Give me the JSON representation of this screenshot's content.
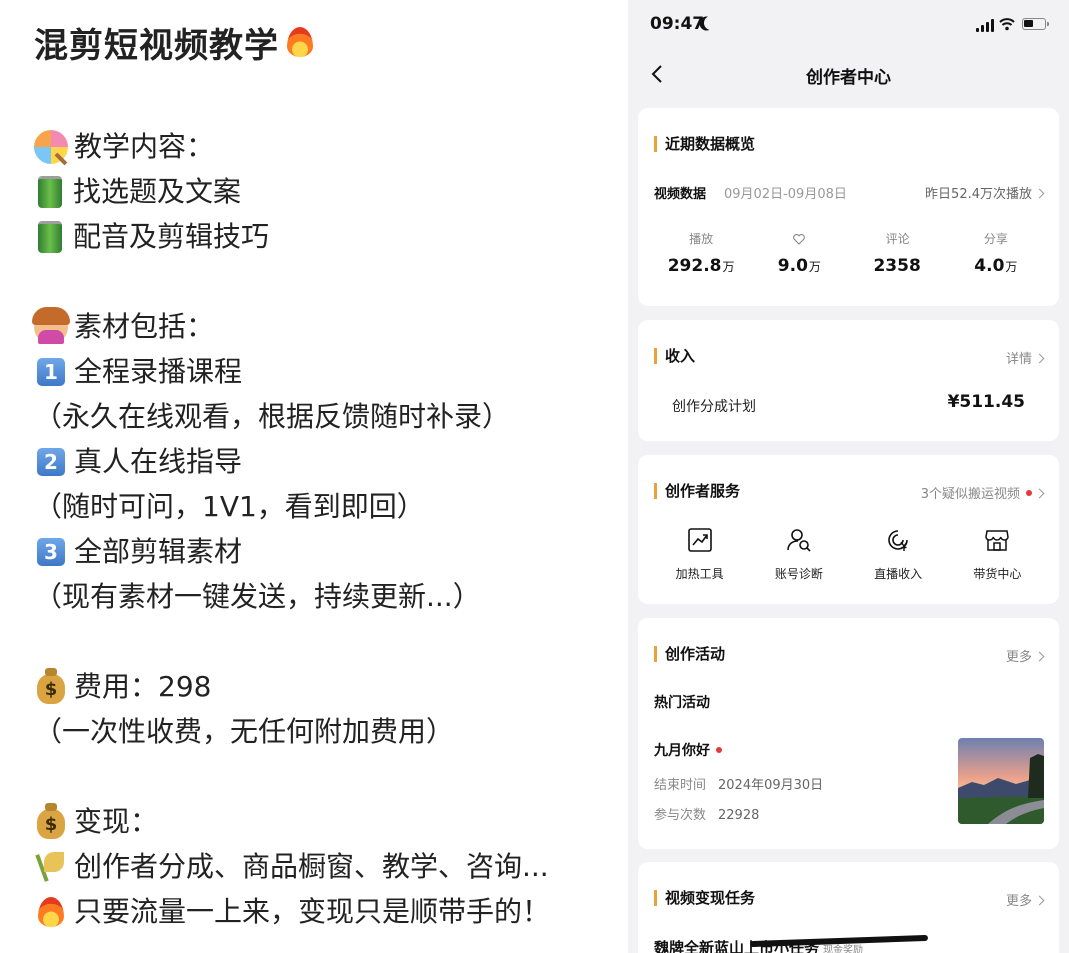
{
  "left": {
    "title": "混剪短视频教学",
    "lines": [
      {
        "icon": "lollipop-icon",
        "text": "教学内容："
      },
      {
        "icon": "battery-can-icon",
        "text": "找选题及文案"
      },
      {
        "icon": "battery-can-icon",
        "text": "配音及剪辑技巧"
      },
      {
        "blank": true
      },
      {
        "icon": "woman-tipping-hand-icon",
        "text": "素材包括："
      },
      {
        "icon": "keycap-1-icon",
        "badge": "1",
        "text": "全程录播课程"
      },
      {
        "text": "（永久在线观看，根据反馈随时补录）"
      },
      {
        "icon": "keycap-2-icon",
        "badge": "2",
        "text": "真人在线指导"
      },
      {
        "text": "（随时可问，1V1，看到即回）"
      },
      {
        "icon": "keycap-3-icon",
        "badge": "3",
        "text": "全部剪辑素材"
      },
      {
        "text": "（现有素材一键发送，持续更新...）"
      },
      {
        "blank": true
      },
      {
        "icon": "money-bag-icon",
        "badge": "$",
        "text": "费用：298"
      },
      {
        "text": "（一次性收费，无任何附加费用）"
      },
      {
        "blank": true
      },
      {
        "icon": "money-bag-icon",
        "badge": "$",
        "text": "变现："
      },
      {
        "icon": "rice-ear-icon",
        "text": "创作者分成、商品橱窗、教学、咨询..."
      },
      {
        "icon": "fire-icon",
        "text": "只要流量一上来，变现只是顺带手的！"
      }
    ]
  },
  "phone": {
    "status": {
      "time": "09:47"
    },
    "nav": {
      "title": "创作者中心"
    },
    "overview": {
      "title": "近期数据概览",
      "video_label": "视频数据",
      "range": "09月02日-09月08日",
      "yesterday": "昨日52.4万次播放",
      "stats": [
        {
          "label": "播放",
          "value": "292.8",
          "unit": "万"
        },
        {
          "label": "",
          "icon": "heart-icon",
          "value": "9.0",
          "unit": "万"
        },
        {
          "label": "评论",
          "value": "2358",
          "unit": ""
        },
        {
          "label": "分享",
          "value": "4.0",
          "unit": "万"
        }
      ]
    },
    "income": {
      "title": "收入",
      "more": "详情",
      "plan": "创作分成计划",
      "amount": "¥511.45"
    },
    "services": {
      "title": "创作者服务",
      "notice": "3个疑似搬运视频",
      "tools": [
        {
          "label": "加热工具",
          "icon": "trend-chart-icon"
        },
        {
          "label": "账号诊断",
          "icon": "user-search-icon"
        },
        {
          "label": "直播收入",
          "icon": "live-yen-icon"
        },
        {
          "label": "带货中心",
          "icon": "shop-icon"
        }
      ]
    },
    "activities": {
      "title": "创作活动",
      "more": "更多",
      "hot": "热门活动",
      "event_name": "九月你好",
      "end_label": "结束时间",
      "end_value": "2024年09月30日",
      "count_label": "参与次数",
      "count_value": "22928"
    },
    "tasks": {
      "title": "视频变现任务",
      "more": "更多",
      "task": "魏牌全新蓝山上市小任务",
      "badge": "现金奖励"
    }
  }
}
